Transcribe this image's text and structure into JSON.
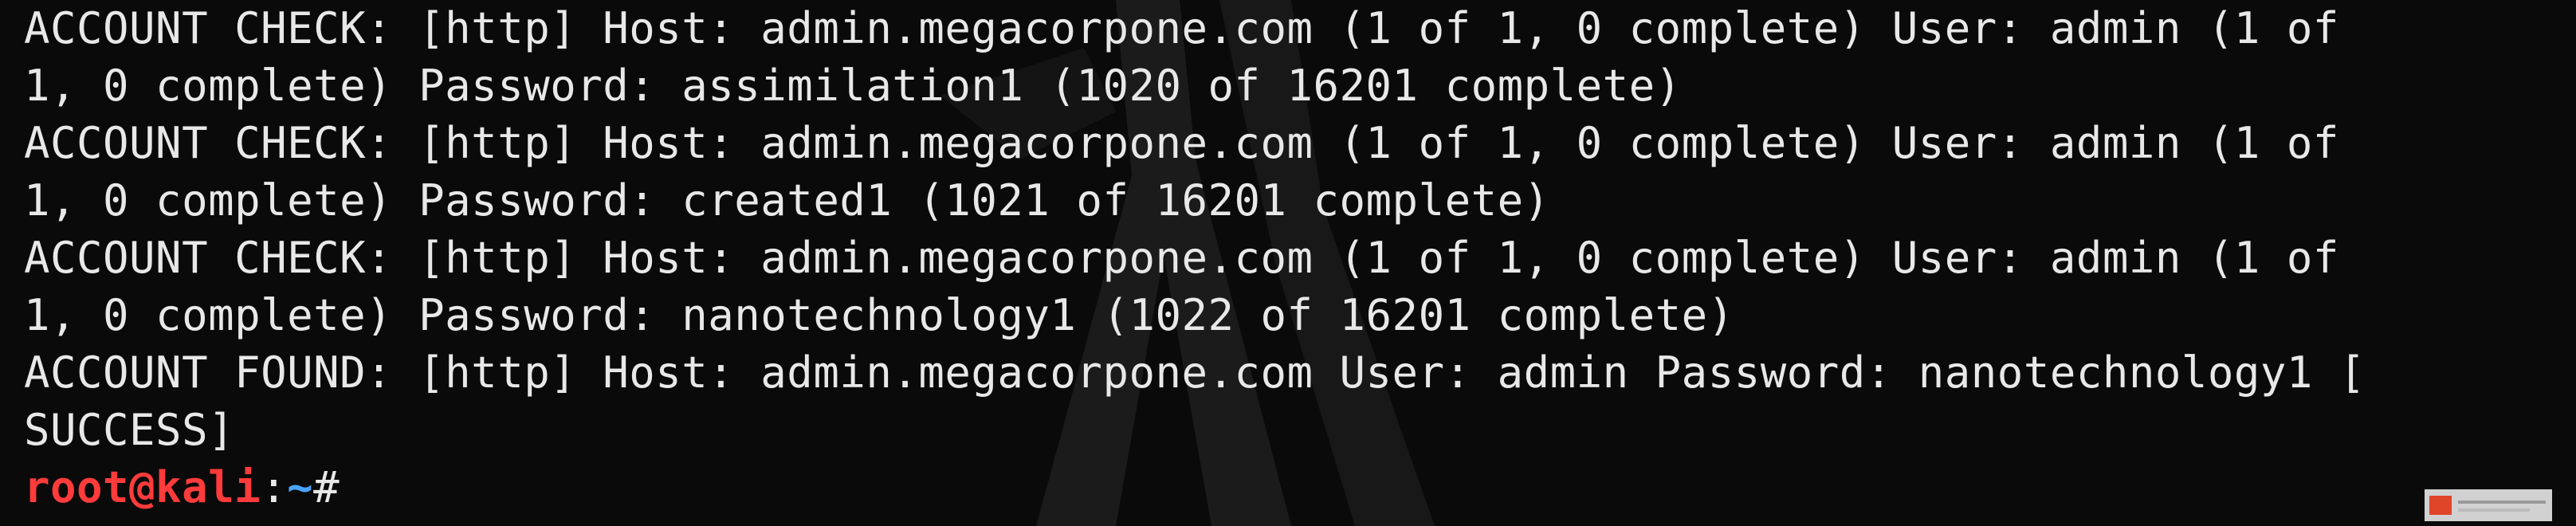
{
  "terminal": {
    "lines": [
      "ACCOUNT CHECK: [http] Host: admin.megacorpone.com (1 of 1, 0 complete) User: admin (1 of",
      "1, 0 complete) Password: assimilation1 (1020 of 16201 complete)",
      "ACCOUNT CHECK: [http] Host: admin.megacorpone.com (1 of 1, 0 complete) User: admin (1 of",
      "1, 0 complete) Password: created1 (1021 of 16201 complete)",
      "ACCOUNT CHECK: [http] Host: admin.megacorpone.com (1 of 1, 0 complete) User: admin (1 of",
      "1, 0 complete) Password: nanotechnology1 (1022 of 16201 complete)",
      "ACCOUNT FOUND: [http] Host: admin.megacorpone.com User: admin Password: nanotechnology1 [",
      "SUCCESS]"
    ],
    "prompt": {
      "user_host": "root@kali",
      "separator": ":",
      "path": "~",
      "symbol": "#"
    }
  },
  "colors": {
    "background": "#0a0a0a",
    "text": "#e8e8e8",
    "prompt_user": "#ff3b3b",
    "prompt_path": "#4aa3ff"
  },
  "icons": {
    "watermark": "kali-dragon-icon",
    "corner": "site-logo-icon"
  }
}
